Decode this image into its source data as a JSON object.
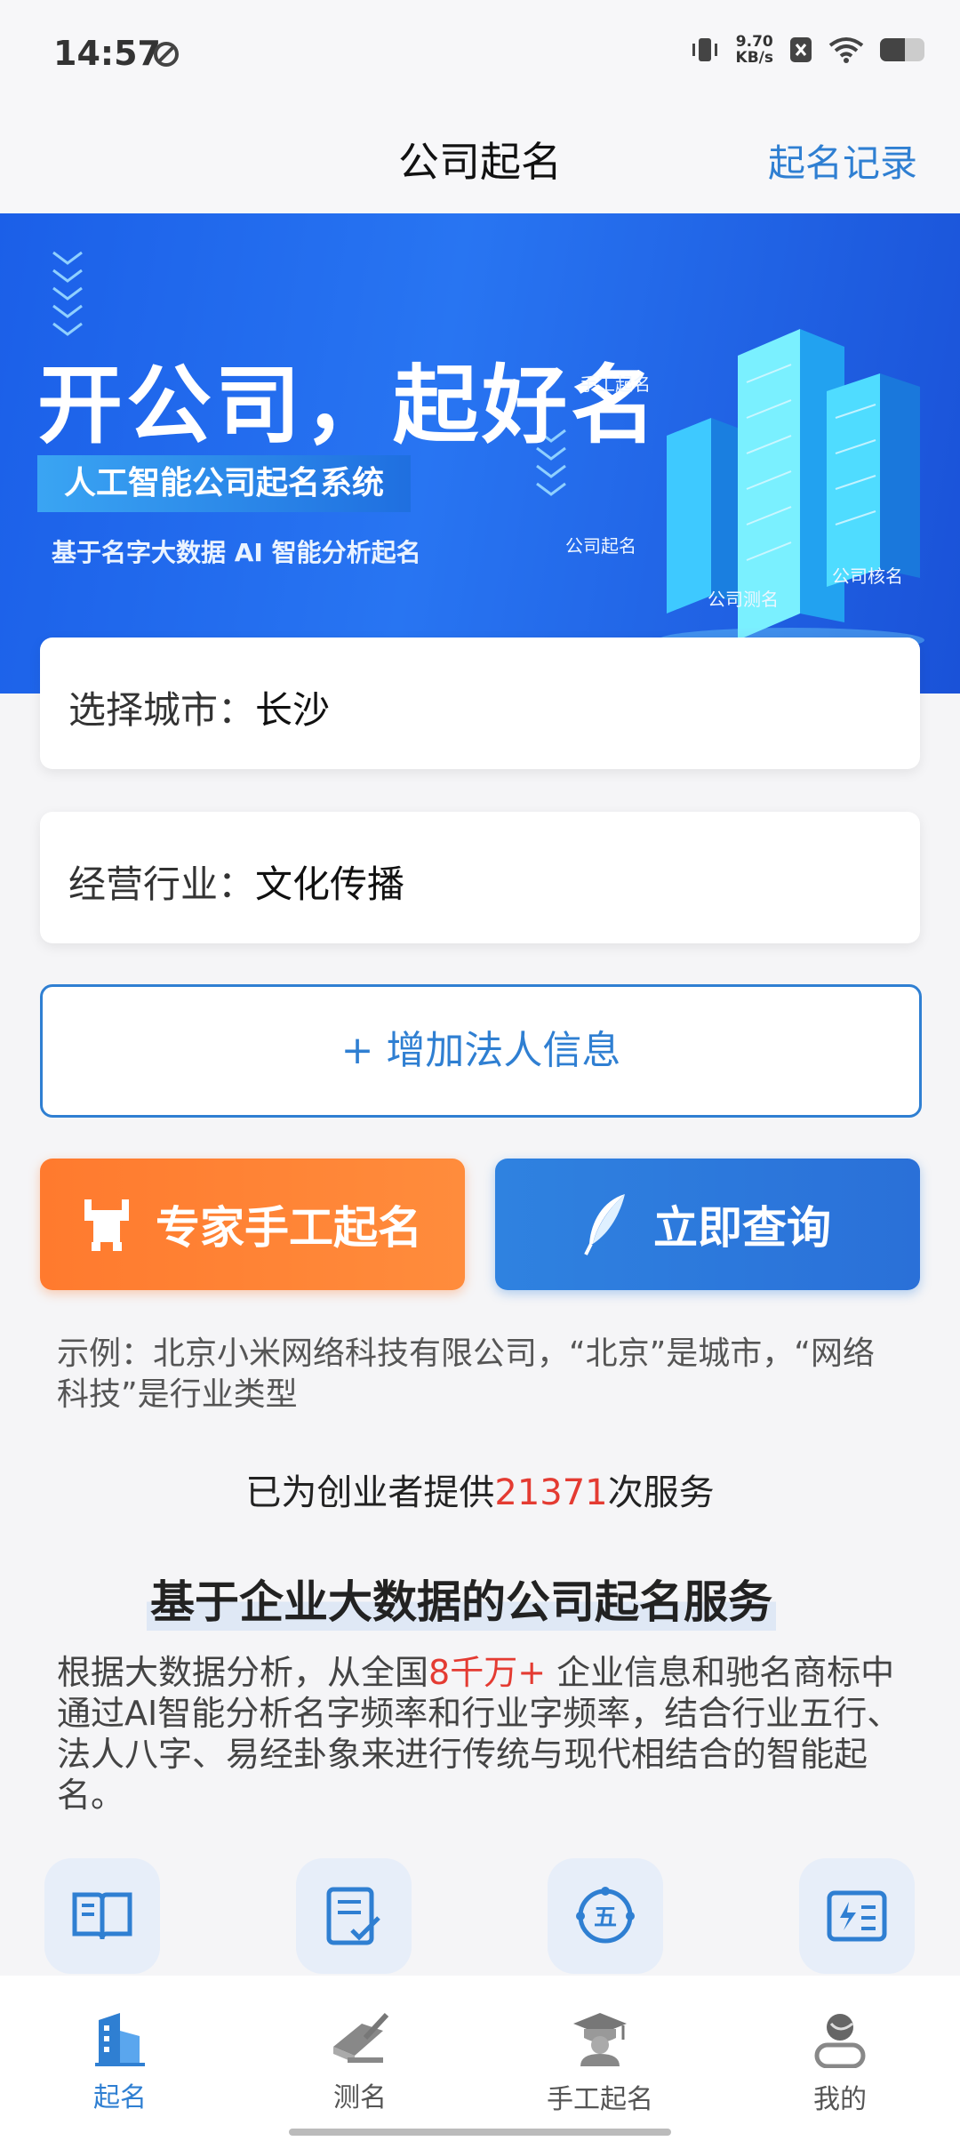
{
  "status": {
    "time": "14:57",
    "speed_top": "9.70",
    "speed_unit": "KB/s",
    "battery_level": 0.55
  },
  "nav": {
    "title": "公司起名",
    "action": "起名记录"
  },
  "banner": {
    "title": "开公司，起好名",
    "pill": "人工智能公司起名系统",
    "subtitle": "基于名字大数据 AI 智能分析起名",
    "labels": [
      "手工起名",
      "公司起名",
      "公司测名",
      "公司核名"
    ]
  },
  "city": {
    "label": "选择城市：",
    "value": "长沙"
  },
  "industry": {
    "label": "经营行业：",
    "value": "文化传播"
  },
  "add_button": "+ 增加法人信息",
  "expert_button": "专家手工起名",
  "query_button": "立即查询",
  "example": "示例：北京小米网络科技有限公司，“北京”是城市，“网络科技”是行业类型",
  "served": {
    "prefix": "已为创业者提供",
    "count": "21371",
    "suffix": "次服务"
  },
  "section_title": "基于企业大数据的公司起名服务",
  "description": {
    "part1": "根据大数据分析，从全国",
    "highlight": "8千万+",
    "part2": " 企业信息和驰名商标中通过AI智能分析名字频率和行业字频率，结合行业五行、法人八字、易经卦象来进行传统与现代相结合的智能起名。"
  },
  "features": [
    "book-icon",
    "checklist-icon",
    "five-elements-icon",
    "lightning-list-icon"
  ],
  "tabs": [
    {
      "label": "起名",
      "icon": "building-icon",
      "active": true
    },
    {
      "label": "测名",
      "icon": "book-pen-icon",
      "active": false
    },
    {
      "label": "手工起名",
      "icon": "scholar-icon",
      "active": false
    },
    {
      "label": "我的",
      "icon": "user-icon",
      "active": false
    }
  ],
  "colors": {
    "accent": "#2f7fd2",
    "orange": "#ff7a2e",
    "highlight": "#e43b32"
  }
}
